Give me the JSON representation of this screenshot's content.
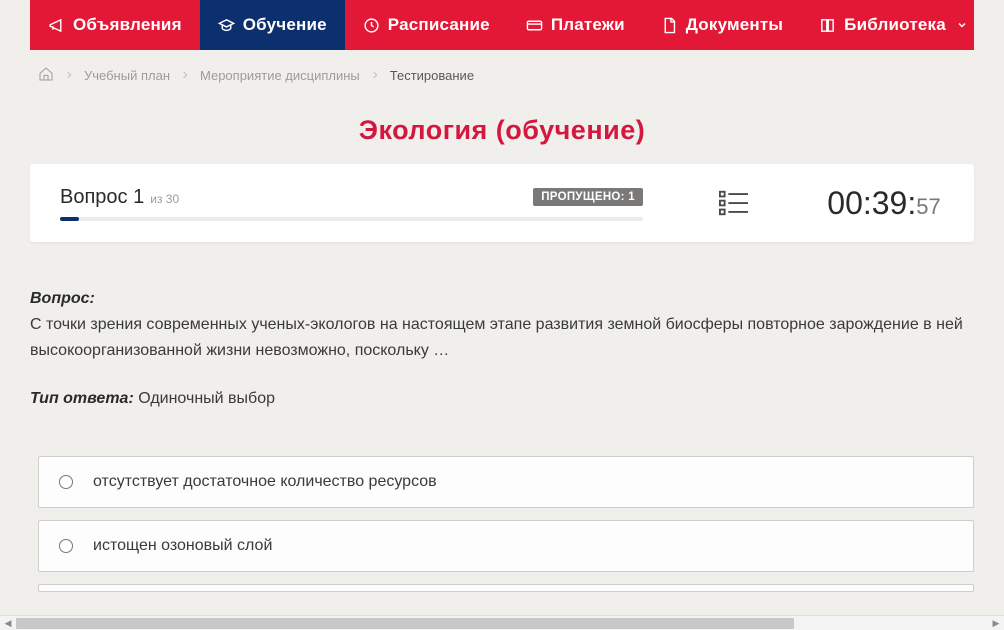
{
  "nav": {
    "items": [
      {
        "label": "Объявления",
        "icon": "megaphone",
        "active": false
      },
      {
        "label": "Обучение",
        "icon": "grad-cap",
        "active": true
      },
      {
        "label": "Расписание",
        "icon": "clock",
        "active": false
      },
      {
        "label": "Платежи",
        "icon": "card",
        "active": false
      },
      {
        "label": "Документы",
        "icon": "doc",
        "active": false
      },
      {
        "label": "Библиотека",
        "icon": "book",
        "active": false,
        "has_dropdown": true
      }
    ]
  },
  "breadcrumb": {
    "items": [
      {
        "label": "Учебный план"
      },
      {
        "label": "Мероприятие дисциплины"
      },
      {
        "label": "Тестирование",
        "current": true
      }
    ]
  },
  "page_title": "Экология (обучение)",
  "status": {
    "question_word": "Вопрос",
    "question_num": "1",
    "of_word": "из",
    "total": "30",
    "skipped_label": "ПРОПУЩЕНО: 1",
    "timer_hm": "00:39:",
    "timer_sec": "57"
  },
  "question": {
    "label": "Вопрос:",
    "text": "С точки зрения современных ученых-экологов на настоящем этапе развития земной биосферы повторное зарождение в ней высокоорганизованной жизни невозможно, поскольку …"
  },
  "answer_type": {
    "label": "Тип ответа:",
    "value": " Одиночный выбор"
  },
  "options": [
    {
      "text": "отсутствует достаточное количество ресурсов"
    },
    {
      "text": "истощен озоновый слой"
    }
  ]
}
